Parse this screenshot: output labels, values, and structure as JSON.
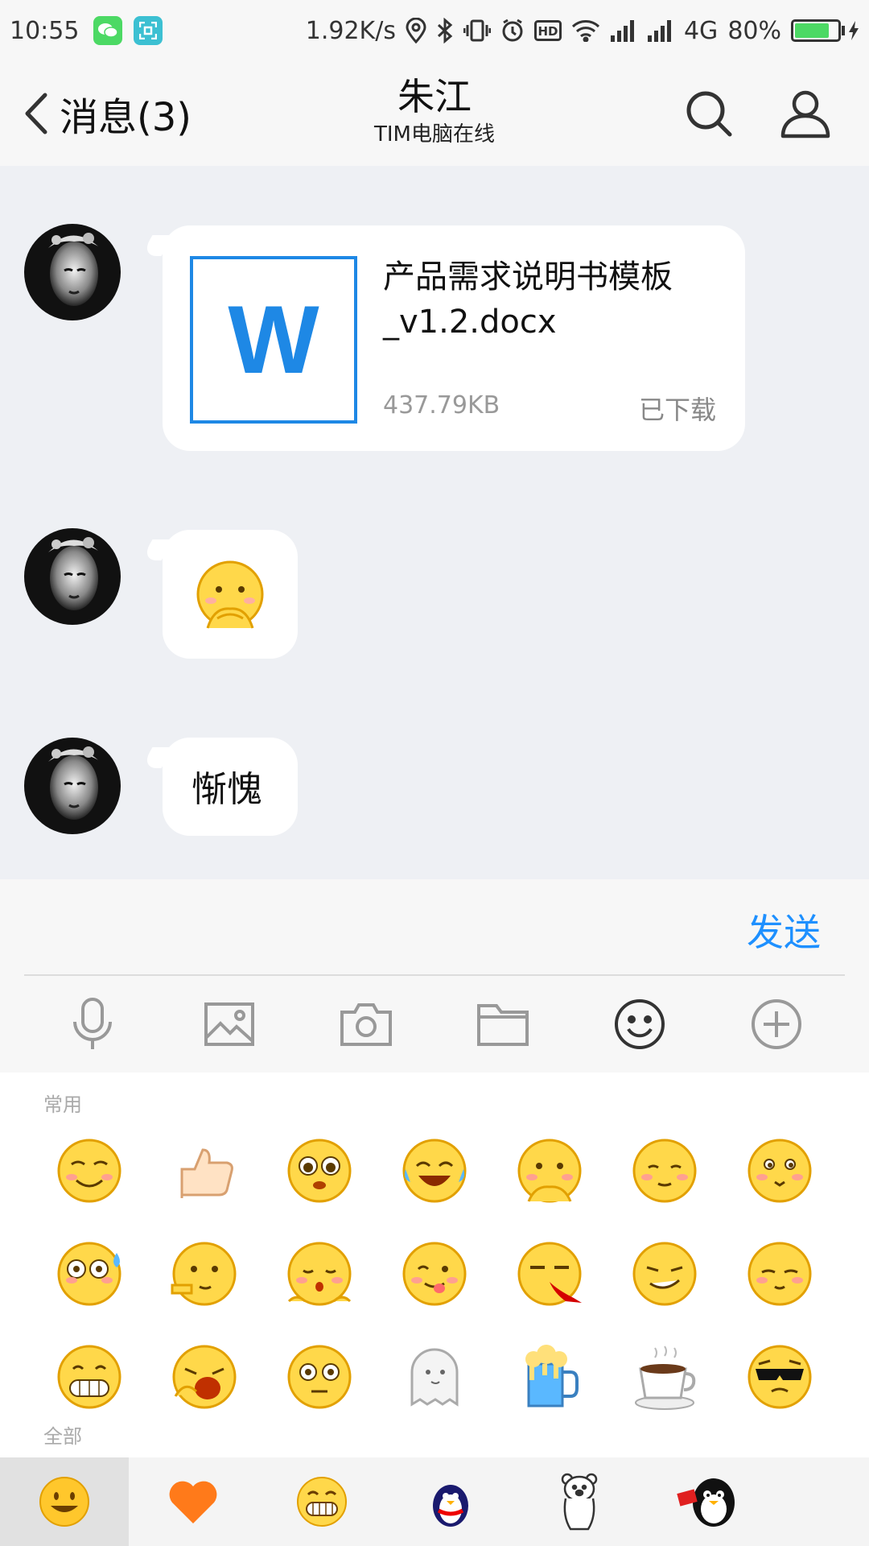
{
  "status_bar": {
    "time": "10:55",
    "speed": "1.92K/s",
    "network": "4G",
    "battery": "80%",
    "battery_level": 0.8
  },
  "header": {
    "back_label": "消息(3)",
    "title": "朱江",
    "subtitle": "TIM电脑在线"
  },
  "messages": [
    {
      "type": "file",
      "file_icon_letter": "W",
      "file_name": "产品需求说明书模板_v1.2.docx",
      "file_size": "437.79KB",
      "status": "已下载"
    },
    {
      "type": "sticker",
      "icon": "shy-hands-emoji"
    },
    {
      "type": "text",
      "text": "惭愧"
    }
  ],
  "input": {
    "send_label": "发送"
  },
  "toolbar": [
    "mic-icon",
    "image-icon",
    "camera-icon",
    "folder-icon",
    "emoji-icon",
    "plus-icon"
  ],
  "emoji_panel": {
    "recent_label": "常用",
    "all_label": "全部",
    "emojis": [
      "smile-blush",
      "thumbs-up",
      "teary-eyes",
      "laughing-tears",
      "shy-hands",
      "sheepish",
      "innocent",
      "sweat-embarrassed",
      "pick-nose",
      "pleading",
      "tongue-out",
      "nosebleed",
      "smirk",
      "pleased",
      "big-grin",
      "yawn",
      "shocked",
      "ghost",
      "beer-mug",
      "coffee-cup",
      "sunglasses-cool"
    ]
  },
  "categories": [
    "smile-category",
    "heart-category",
    "grin-category",
    "penguin-category",
    "bear-category",
    "qq-penguin-category"
  ],
  "colors": {
    "accent": "#1e90ff",
    "emoji_yellow": "#ffd84a",
    "emoji_outline": "#e2a000"
  }
}
